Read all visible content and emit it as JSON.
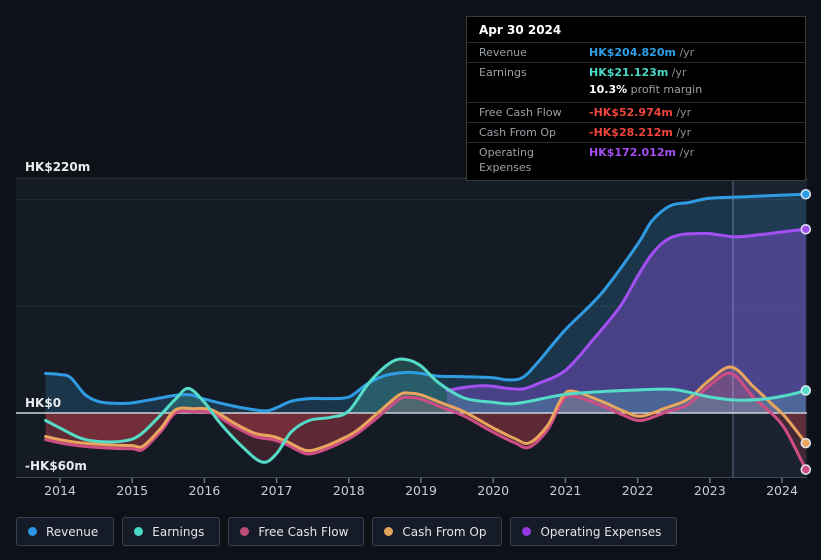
{
  "y_axis": {
    "top_label": "HK$220m",
    "zero_label": "HK$0",
    "bottom_label": "-HK$60m"
  },
  "x_axis": {
    "years": [
      "2014",
      "2015",
      "2016",
      "2017",
      "2018",
      "2019",
      "2020",
      "2021",
      "2022",
      "2023",
      "2024"
    ]
  },
  "tooltip": {
    "date": "Apr 30 2024",
    "rows": [
      {
        "label": "Revenue",
        "value": "HK$204.820m",
        "suffix": " /yr",
        "color": "#2e9fe8"
      },
      {
        "label": "Earnings",
        "value": "HK$21.123m",
        "suffix": " /yr",
        "color": "#49d9c5"
      },
      {
        "label": "Free Cash Flow",
        "value": "-HK$52.974m",
        "suffix": " /yr",
        "color": "#ef453d"
      },
      {
        "label": "Cash From Op",
        "value": "-HK$28.212m",
        "suffix": " /yr",
        "color": "#ef453d"
      },
      {
        "label": "Operating Expenses",
        "value": "HK$172.012m",
        "suffix": " /yr",
        "color": "#a64df0"
      }
    ],
    "profit_margin": {
      "value": "10.3%",
      "text": " profit margin"
    }
  },
  "legend": [
    {
      "label": "Revenue",
      "color": "#2e96e6"
    },
    {
      "label": "Earnings",
      "color": "#49d9c5"
    },
    {
      "label": "Free Cash Flow",
      "color": "#bb4d78"
    },
    {
      "label": "Cash From Op",
      "color": "#e0a35c"
    },
    {
      "label": "Operating Expenses",
      "color": "#9138e0"
    }
  ],
  "chart_data": {
    "type": "area",
    "title": "Earnings and revenue history (HK$ millions per year)",
    "x_domain": [
      2013.8,
      2024.35
    ],
    "y_max_label_value": 220,
    "y_min_value": -60,
    "gridlines": [
      220,
      200,
      100
    ],
    "zero_value": 0,
    "highlight_from_x": 2023.32,
    "last_point_date": "Apr 30 2024",
    "series": [
      {
        "name": "Revenue",
        "color": "#2f9be3",
        "fill": "rgba(52,150,215,0.22)",
        "points": [
          [
            2013.8,
            37
          ],
          [
            2014.0,
            36
          ],
          [
            2014.15,
            33
          ],
          [
            2014.35,
            17
          ],
          [
            2014.55,
            10.5
          ],
          [
            2014.8,
            9
          ],
          [
            2015.0,
            9.5
          ],
          [
            2015.3,
            13
          ],
          [
            2015.6,
            16.5
          ],
          [
            2015.8,
            17
          ],
          [
            2016.0,
            13
          ],
          [
            2016.3,
            8
          ],
          [
            2016.6,
            4
          ],
          [
            2016.85,
            2
          ],
          [
            2017.0,
            5
          ],
          [
            2017.2,
            11
          ],
          [
            2017.45,
            13.5
          ],
          [
            2017.7,
            13.5
          ],
          [
            2018.0,
            15
          ],
          [
            2018.25,
            27
          ],
          [
            2018.5,
            35
          ],
          [
            2018.8,
            38
          ],
          [
            2019.0,
            37
          ],
          [
            2019.25,
            34.5
          ],
          [
            2019.6,
            34
          ],
          [
            2020.0,
            33
          ],
          [
            2020.2,
            31
          ],
          [
            2020.4,
            33
          ],
          [
            2020.6,
            46
          ],
          [
            2021.0,
            78
          ],
          [
            2021.5,
            112
          ],
          [
            2022.0,
            158
          ],
          [
            2022.2,
            180
          ],
          [
            2022.45,
            194
          ],
          [
            2022.7,
            197
          ],
          [
            2023.0,
            201
          ],
          [
            2023.5,
            202.5
          ],
          [
            2024.0,
            204
          ],
          [
            2024.33,
            204.82
          ]
        ]
      },
      {
        "name": "Operating Expenses",
        "color": "#a44ff2",
        "fill": "rgba(148,84,233,0.38)",
        "points": [
          [
            2019.36,
            21
          ],
          [
            2019.6,
            24
          ],
          [
            2019.85,
            25.5
          ],
          [
            2020.0,
            25
          ],
          [
            2020.2,
            23
          ],
          [
            2020.4,
            22.5
          ],
          [
            2020.6,
            27
          ],
          [
            2021.0,
            40
          ],
          [
            2021.4,
            70
          ],
          [
            2021.76,
            100
          ],
          [
            2022.0,
            128
          ],
          [
            2022.2,
            149
          ],
          [
            2022.4,
            162
          ],
          [
            2022.6,
            167
          ],
          [
            2022.8,
            168
          ],
          [
            2023.0,
            168
          ],
          [
            2023.35,
            165
          ],
          [
            2023.7,
            167
          ],
          [
            2024.0,
            169.5
          ],
          [
            2024.33,
            172.01
          ]
        ]
      },
      {
        "name": "Free Cash Flow",
        "color": "#cf4d85",
        "fill": "rgba(212,80,140,0.16)",
        "points": [
          [
            2013.8,
            -25
          ],
          [
            2014.0,
            -28
          ],
          [
            2014.3,
            -31
          ],
          [
            2014.7,
            -33
          ],
          [
            2015.0,
            -33.5
          ],
          [
            2015.15,
            -34
          ],
          [
            2015.4,
            -17
          ],
          [
            2015.6,
            0
          ],
          [
            2015.85,
            1
          ],
          [
            2016.1,
            0
          ],
          [
            2016.4,
            -12
          ],
          [
            2016.7,
            -22
          ],
          [
            2016.95,
            -25
          ],
          [
            2017.15,
            -30
          ],
          [
            2017.4,
            -38
          ],
          [
            2017.6,
            -36
          ],
          [
            2017.85,
            -29
          ],
          [
            2018.1,
            -20
          ],
          [
            2018.4,
            -4
          ],
          [
            2018.7,
            13
          ],
          [
            2018.85,
            14.5
          ],
          [
            2019.0,
            13
          ],
          [
            2019.3,
            5
          ],
          [
            2019.6,
            -3
          ],
          [
            2020.0,
            -18
          ],
          [
            2020.3,
            -28
          ],
          [
            2020.5,
            -32
          ],
          [
            2020.75,
            -16
          ],
          [
            2020.95,
            10
          ],
          [
            2021.1,
            16
          ],
          [
            2021.5,
            7
          ],
          [
            2021.8,
            -2
          ],
          [
            2022.05,
            -7
          ],
          [
            2022.4,
            1
          ],
          [
            2022.7,
            8
          ],
          [
            2023.0,
            26
          ],
          [
            2023.3,
            37
          ],
          [
            2023.6,
            15
          ],
          [
            2023.85,
            0
          ],
          [
            2024.05,
            -16
          ],
          [
            2024.33,
            -52.97
          ]
        ]
      },
      {
        "name": "Cash From Op",
        "color": "#e9a55d",
        "fill": "rgba(235,165,95,0.12)",
        "points": [
          [
            2013.8,
            -22
          ],
          [
            2014.0,
            -25
          ],
          [
            2014.3,
            -28
          ],
          [
            2014.7,
            -30
          ],
          [
            2015.0,
            -30.5
          ],
          [
            2015.15,
            -31
          ],
          [
            2015.4,
            -14
          ],
          [
            2015.6,
            3
          ],
          [
            2015.85,
            4
          ],
          [
            2016.1,
            3
          ],
          [
            2016.4,
            -9
          ],
          [
            2016.7,
            -19
          ],
          [
            2016.95,
            -22
          ],
          [
            2017.15,
            -27
          ],
          [
            2017.4,
            -35
          ],
          [
            2017.6,
            -33
          ],
          [
            2017.85,
            -26
          ],
          [
            2018.1,
            -17
          ],
          [
            2018.4,
            0
          ],
          [
            2018.7,
            17
          ],
          [
            2018.85,
            18.5
          ],
          [
            2019.0,
            17
          ],
          [
            2019.3,
            9
          ],
          [
            2019.6,
            1
          ],
          [
            2020.0,
            -14
          ],
          [
            2020.3,
            -24
          ],
          [
            2020.5,
            -28
          ],
          [
            2020.75,
            -12
          ],
          [
            2020.95,
            14
          ],
          [
            2021.1,
            20.5
          ],
          [
            2021.5,
            11
          ],
          [
            2021.8,
            2
          ],
          [
            2022.05,
            -3
          ],
          [
            2022.4,
            5
          ],
          [
            2022.7,
            13
          ],
          [
            2023.0,
            31
          ],
          [
            2023.3,
            43
          ],
          [
            2023.6,
            25
          ],
          [
            2023.85,
            9
          ],
          [
            2024.05,
            -4
          ],
          [
            2024.33,
            -28.21
          ]
        ]
      },
      {
        "name": "Earnings",
        "color": "#55dcc8",
        "fill": "rgba(85,215,195,0.24)",
        "points": [
          [
            2013.8,
            -7
          ],
          [
            2014.0,
            -14
          ],
          [
            2014.3,
            -24
          ],
          [
            2014.6,
            -27
          ],
          [
            2014.9,
            -26
          ],
          [
            2015.1,
            -21
          ],
          [
            2015.35,
            -5
          ],
          [
            2015.6,
            13
          ],
          [
            2015.78,
            23
          ],
          [
            2016.0,
            10
          ],
          [
            2016.2,
            -8
          ],
          [
            2016.5,
            -30
          ],
          [
            2016.8,
            -46
          ],
          [
            2017.0,
            -38
          ],
          [
            2017.2,
            -18
          ],
          [
            2017.45,
            -7
          ],
          [
            2017.75,
            -4
          ],
          [
            2018.0,
            2
          ],
          [
            2018.3,
            30
          ],
          [
            2018.6,
            48
          ],
          [
            2018.8,
            50
          ],
          [
            2019.0,
            44
          ],
          [
            2019.25,
            28
          ],
          [
            2019.6,
            14
          ],
          [
            2020.0,
            10
          ],
          [
            2020.25,
            8.5
          ],
          [
            2020.5,
            11
          ],
          [
            2021.0,
            17.5
          ],
          [
            2021.5,
            20
          ],
          [
            2022.0,
            21.5
          ],
          [
            2022.5,
            22
          ],
          [
            2023.0,
            15
          ],
          [
            2023.4,
            12
          ],
          [
            2023.8,
            13.5
          ],
          [
            2024.1,
            17
          ],
          [
            2024.33,
            21.12
          ]
        ]
      }
    ],
    "negative_fill": "rgba(205,62,78,0.22)"
  }
}
